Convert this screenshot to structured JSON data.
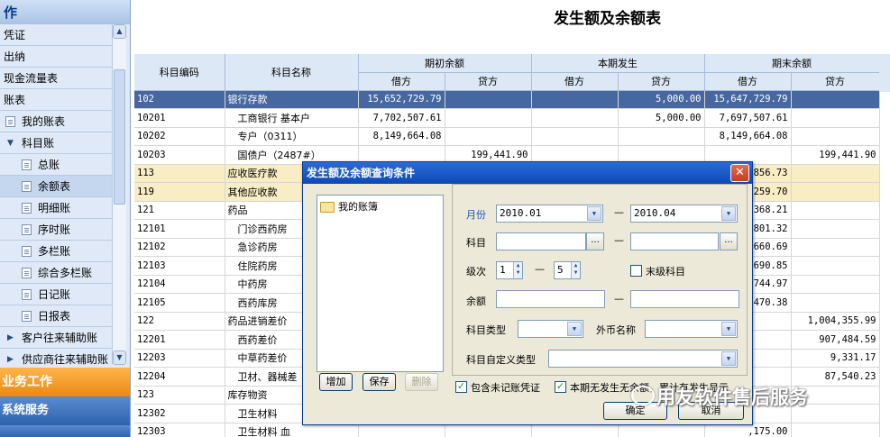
{
  "nav": {
    "header": "作",
    "items": [
      {
        "label": "凭证",
        "level": 0
      },
      {
        "label": "出纳",
        "level": 0
      },
      {
        "label": "现金流量表",
        "level": 0
      },
      {
        "label": "账表",
        "level": 0
      },
      {
        "label": "我的账表",
        "level": 1,
        "icon": "doc-icon"
      },
      {
        "label": "科目账",
        "level": 1,
        "icon": "expand-down-icon"
      },
      {
        "label": "总账",
        "level": 2,
        "icon": "doc-icon"
      },
      {
        "label": "余额表",
        "level": 2,
        "icon": "doc-icon",
        "selected": true
      },
      {
        "label": "明细账",
        "level": 2,
        "icon": "doc-icon"
      },
      {
        "label": "序时账",
        "level": 2,
        "icon": "doc-icon"
      },
      {
        "label": "多栏账",
        "level": 2,
        "icon": "doc-icon"
      },
      {
        "label": "综合多栏账",
        "level": 2,
        "icon": "doc-icon"
      },
      {
        "label": "日记账",
        "level": 2,
        "icon": "doc-icon"
      },
      {
        "label": "日报表",
        "level": 2,
        "icon": "doc-icon"
      },
      {
        "label": "客户往来辅助账",
        "level": 1,
        "icon": "expand-right-icon"
      },
      {
        "label": "供应商往来辅助账",
        "level": 1,
        "icon": "expand-right-icon"
      }
    ],
    "work": "业务工作",
    "system": "系统服务"
  },
  "report": {
    "title": "发生额及余额表",
    "headers": {
      "code": "科目编码",
      "name": "科目名称",
      "opening": "期初余额",
      "period": "本期发生",
      "closing": "期末余额",
      "debit": "借方",
      "credit": "贷方"
    },
    "rows": [
      {
        "code": "102",
        "name": "银行存款",
        "od": "15,652,729.79",
        "oc": "",
        "pd": "",
        "pc": "5,000.00",
        "cd": "15,647,729.79",
        "cc": "",
        "state": "selected"
      },
      {
        "code": "10201",
        "name": "工商银行 基本户",
        "od": "7,702,507.61",
        "oc": "",
        "pd": "",
        "pc": "5,000.00",
        "cd": "7,697,507.61",
        "cc": "",
        "indent": true
      },
      {
        "code": "10202",
        "name": "专户（0311）",
        "od": "8,149,664.08",
        "oc": "",
        "pd": "",
        "pc": "",
        "cd": "8,149,664.08",
        "cc": "",
        "indent": true
      },
      {
        "code": "10203",
        "name": "国债户（2487#）",
        "od": "",
        "oc": "199,441.90",
        "pd": "",
        "pc": "",
        "cd": "",
        "cc": "199,441.90",
        "indent": true
      },
      {
        "code": "113",
        "name": "应收医疗款",
        "od": "",
        "oc": "",
        "pd": "",
        "pc": "",
        "cd": "856.73",
        "cc": "",
        "state": "highlight"
      },
      {
        "code": "119",
        "name": "其他应收款",
        "od": "",
        "oc": "",
        "pd": "",
        "pc": "",
        "cd": "259.70",
        "cc": "",
        "state": "highlight"
      },
      {
        "code": "121",
        "name": "药品",
        "od": "",
        "oc": "",
        "pd": "",
        "pc": "",
        "cd": "368.21",
        "cc": ""
      },
      {
        "code": "12101",
        "name": "门诊西药房",
        "od": "",
        "oc": "",
        "pd": "",
        "pc": "",
        "cd": "801.32",
        "cc": "",
        "indent": true
      },
      {
        "code": "12102",
        "name": "急诊药房",
        "od": "",
        "oc": "",
        "pd": "",
        "pc": "",
        "cd": "660.69",
        "cc": "",
        "indent": true
      },
      {
        "code": "12103",
        "name": "住院药房",
        "od": "",
        "oc": "",
        "pd": "",
        "pc": "",
        "cd": "690.85",
        "cc": "",
        "indent": true
      },
      {
        "code": "12104",
        "name": "中药房",
        "od": "",
        "oc": "",
        "pd": "",
        "pc": "",
        "cd": "744.97",
        "cc": "",
        "indent": true
      },
      {
        "code": "12105",
        "name": "西药库房",
        "od": "",
        "oc": "",
        "pd": "",
        "pc": "",
        "cd": "470.38",
        "cc": "",
        "indent": true
      },
      {
        "code": "122",
        "name": "药品进销差价",
        "od": "",
        "oc": "",
        "pd": "",
        "pc": "",
        "cd": "",
        "cc": "1,004,355.99"
      },
      {
        "code": "12201",
        "name": "西药差价",
        "od": "",
        "oc": "",
        "pd": "",
        "pc": "",
        "cd": "",
        "cc": "907,484.59",
        "indent": true
      },
      {
        "code": "12203",
        "name": "中草药差价",
        "od": "",
        "oc": "",
        "pd": "",
        "pc": "",
        "cd": "",
        "cc": "9,331.17",
        "indent": true
      },
      {
        "code": "12204",
        "name": "卫材、器械差",
        "od": "",
        "oc": "",
        "pd": "",
        "pc": "",
        "cd": "",
        "cc": "87,540.23",
        "indent": true
      },
      {
        "code": "123",
        "name": "库存物资",
        "od": "",
        "oc": "",
        "pd": "",
        "pc": "",
        "cd": "",
        "cc": ""
      },
      {
        "code": "12302",
        "name": "卫生材料",
        "od": "",
        "oc": "",
        "pd": "",
        "pc": "",
        "cd": "",
        "cc": "",
        "indent": true
      },
      {
        "code": "12303",
        "name": "卫生材料 血",
        "od": "",
        "oc": "",
        "pd": "",
        "pc": "",
        "cd": ",175.00",
        "cc": "",
        "indent": true
      }
    ]
  },
  "dialog": {
    "title": "发生额及余额查询条件",
    "tree_item": "我的账簿",
    "buttons": {
      "add": "增加",
      "save": "保存",
      "delete": "删除",
      "ok": "确定",
      "cancel": "取消"
    },
    "month_label": "月份",
    "month_from": "2010.01",
    "month_to": "2010.04",
    "subject_label": "科目",
    "level_label": "级次",
    "level_from": "1",
    "level_to": "5",
    "leaf_label": "末级科目",
    "balance_label": "余额",
    "subject_type_label": "科目类型",
    "currency_label": "外币名称",
    "custom_type_label": "科目自定义类型",
    "ellipsis": "...",
    "dash": "—",
    "opt1": "包含未记账凭证",
    "opt2": "本期无发生无余额，累计有发生显示"
  },
  "watermark": "用友软件售后服务"
}
